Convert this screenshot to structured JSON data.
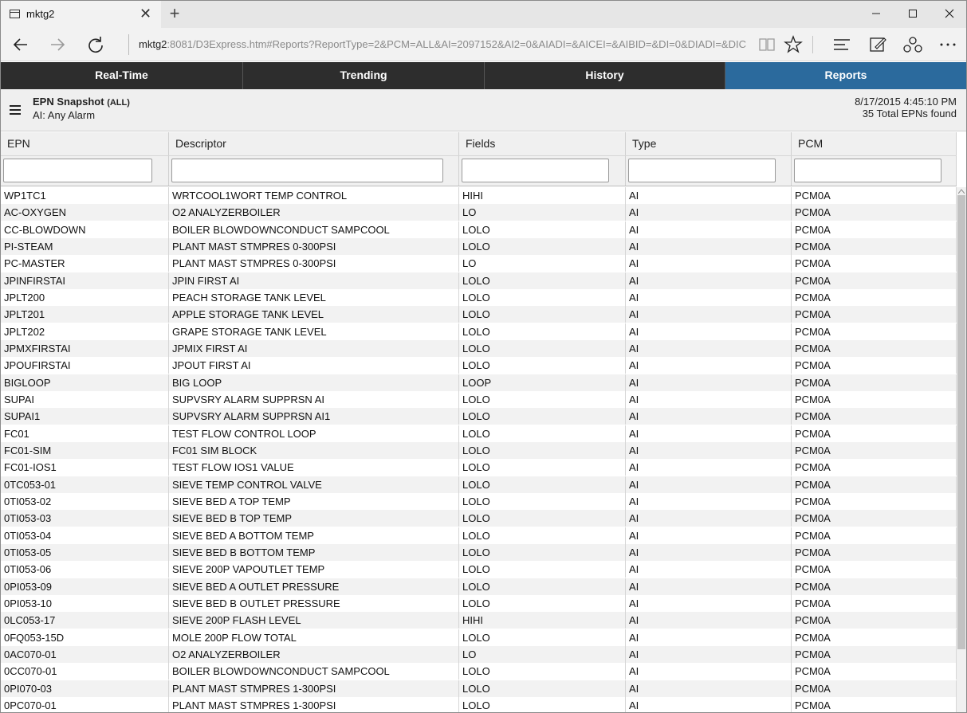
{
  "browser": {
    "tab_title": "mktg2",
    "tab_close": "✕",
    "new_tab": "+",
    "url_host": "mktg2",
    "url_rest": ":8081/D3Express.htm#Reports?ReportType=2&PCM=ALL&AI=2097152&AI2=0&AIADI=&AICEI=&AIBID=&DI=0&DIADI=&DIC"
  },
  "nav": {
    "tabs": [
      "Real-Time",
      "Trending",
      "History",
      "Reports"
    ],
    "active": "Reports"
  },
  "report": {
    "title": "EPN Snapshot",
    "scope": "(ALL)",
    "subtitle": "AI: Any Alarm",
    "timestamp": "8/17/2015 4:45:10 PM",
    "count_text": "35 Total EPNs found"
  },
  "grid": {
    "columns": [
      "EPN",
      "Descriptor",
      "Fields",
      "Type",
      "PCM"
    ],
    "rows": [
      [
        "WP1TC1",
        "WRTCOOL1WORT TEMP CONTROL",
        "HIHI",
        "AI",
        "PCM0A"
      ],
      [
        "AC-OXYGEN",
        "O2 ANALYZERBOILER",
        "LO",
        "AI",
        "PCM0A"
      ],
      [
        "CC-BLOWDOWN",
        "BOILER BLOWDOWNCONDUCT SAMPCOOL",
        "LOLO",
        "AI",
        "PCM0A"
      ],
      [
        "PI-STEAM",
        "PLANT MAST STMPRES 0-300PSI",
        "LOLO",
        "AI",
        "PCM0A"
      ],
      [
        "PC-MASTER",
        "PLANT MAST STMPRES 0-300PSI",
        "LO",
        "AI",
        "PCM0A"
      ],
      [
        "JPINFIRSTAI",
        "JPIN FIRST AI",
        "LOLO",
        "AI",
        "PCM0A"
      ],
      [
        "JPLT200",
        "PEACH STORAGE TANK LEVEL",
        "LOLO",
        "AI",
        "PCM0A"
      ],
      [
        "JPLT201",
        "APPLE STORAGE TANK LEVEL",
        "LOLO",
        "AI",
        "PCM0A"
      ],
      [
        "JPLT202",
        "GRAPE STORAGE TANK LEVEL",
        "LOLO",
        "AI",
        "PCM0A"
      ],
      [
        "JPMXFIRSTAI",
        "JPMIX FIRST AI",
        "LOLO",
        "AI",
        "PCM0A"
      ],
      [
        "JPOUFIRSTAI",
        "JPOUT FIRST AI",
        "LOLO",
        "AI",
        "PCM0A"
      ],
      [
        "BIGLOOP",
        "BIG LOOP",
        "LOOP",
        "AI",
        "PCM0A"
      ],
      [
        "SUPAI",
        "SUPVSRY ALARM SUPPRSN AI",
        "LOLO",
        "AI",
        "PCM0A"
      ],
      [
        "SUPAI1",
        "SUPVSRY ALARM SUPPRSN AI1",
        "LOLO",
        "AI",
        "PCM0A"
      ],
      [
        "FC01",
        "TEST FLOW CONTROL LOOP",
        "LOLO",
        "AI",
        "PCM0A"
      ],
      [
        "FC01-SIM",
        "FC01 SIM BLOCK",
        "LOLO",
        "AI",
        "PCM0A"
      ],
      [
        "FC01-IOS1",
        "TEST FLOW IOS1 VALUE",
        "LOLO",
        "AI",
        "PCM0A"
      ],
      [
        "0TC053-01",
        "SIEVE TEMP CONTROL VALVE",
        "LOLO",
        "AI",
        "PCM0A"
      ],
      [
        "0TI053-02",
        "SIEVE BED A TOP TEMP",
        "LOLO",
        "AI",
        "PCM0A"
      ],
      [
        "0TI053-03",
        "SIEVE BED B TOP TEMP",
        "LOLO",
        "AI",
        "PCM0A"
      ],
      [
        "0TI053-04",
        "SIEVE BED A BOTTOM TEMP",
        "LOLO",
        "AI",
        "PCM0A"
      ],
      [
        "0TI053-05",
        "SIEVE BED B BOTTOM TEMP",
        "LOLO",
        "AI",
        "PCM0A"
      ],
      [
        "0TI053-06",
        "SIEVE 200P VAPOUTLET TEMP",
        "LOLO",
        "AI",
        "PCM0A"
      ],
      [
        "0PI053-09",
        "SIEVE BED A OUTLET PRESSURE",
        "LOLO",
        "AI",
        "PCM0A"
      ],
      [
        "0PI053-10",
        "SIEVE BED B OUTLET PRESSURE",
        "LOLO",
        "AI",
        "PCM0A"
      ],
      [
        "0LC053-17",
        "SIEVE 200P FLASH LEVEL",
        "HIHI",
        "AI",
        "PCM0A"
      ],
      [
        "0FQ053-15D",
        "MOLE 200P FLOW TOTAL",
        "LOLO",
        "AI",
        "PCM0A"
      ],
      [
        "0AC070-01",
        "O2 ANALYZERBOILER",
        "LO",
        "AI",
        "PCM0A"
      ],
      [
        "0CC070-01",
        "BOILER BLOWDOWNCONDUCT SAMPCOOL",
        "LOLO",
        "AI",
        "PCM0A"
      ],
      [
        "0PI070-03",
        "PLANT MAST STMPRES 1-300PSI",
        "LOLO",
        "AI",
        "PCM0A"
      ],
      [
        "0PC070-01",
        "PLANT MAST STMPRES 1-300PSI",
        "LOLO",
        "AI",
        "PCM0A"
      ]
    ]
  },
  "colors": {
    "nav_bg": "#2d2d2d",
    "nav_active": "#2b6a9d",
    "row_alt": "#f2f2f2"
  }
}
